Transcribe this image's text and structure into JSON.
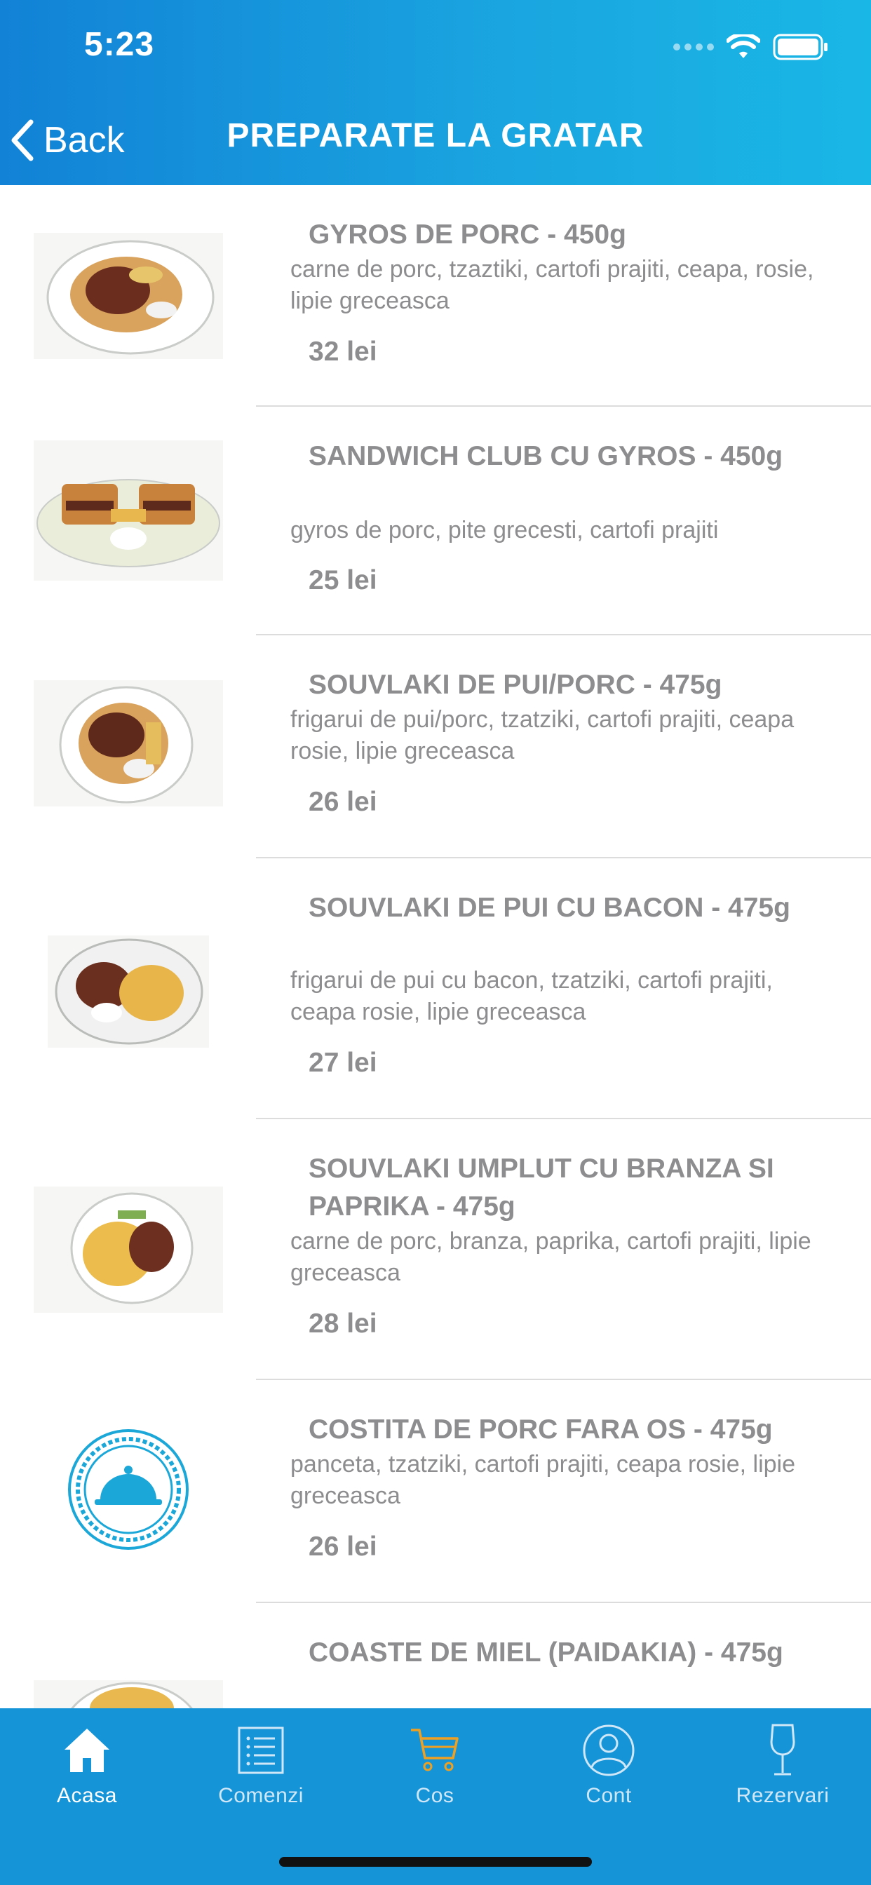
{
  "status_bar": {
    "time": "5:23"
  },
  "nav": {
    "back_label": "Back",
    "title": "PREPARATE LA GRATAR"
  },
  "items": [
    {
      "title": "GYROS DE PORC - 450g",
      "description": "carne de porc, tzaztiki, cartofi prajiti, ceapa, rosie, lipie greceasca",
      "price": "32 lei"
    },
    {
      "title": "SANDWICH CLUB CU GYROS - 450g",
      "description": "gyros de porc, pite grecesti, cartofi prajiti",
      "price": "25 lei"
    },
    {
      "title": "SOUVLAKI DE PUI/PORC - 475g",
      "description": "frigarui de pui/porc, tzatziki, cartofi prajiti, ceapa rosie, lipie greceasca",
      "price": "26 lei"
    },
    {
      "title": "SOUVLAKI DE PUI CU BACON - 475g",
      "description": "frigarui de pui cu bacon, tzatziki, cartofi prajiti, ceapa rosie, lipie greceasca",
      "price": "27 lei"
    },
    {
      "title": "SOUVLAKI UMPLUT CU BRANZA SI PAPRIKA - 475g",
      "description": "carne de porc, branza, paprika, cartofi prajiti, lipie greceasca",
      "price": "28 lei"
    },
    {
      "title": "COSTITA DE PORC FARA OS - 475g",
      "description": "panceta, tzatziki, cartofi prajiti, ceapa rosie, lipie greceasca",
      "price": "26 lei"
    },
    {
      "title": "COASTE DE MIEL (PAIDAKIA) - 475g",
      "description": "",
      "price": ""
    }
  ],
  "tabs": [
    {
      "label": "Acasa",
      "icon": "home-icon"
    },
    {
      "label": "Comenzi",
      "icon": "orders-list-icon"
    },
    {
      "label": "Cos",
      "icon": "cart-icon"
    },
    {
      "label": "Cont",
      "icon": "account-icon"
    },
    {
      "label": "Rezervari",
      "icon": "wine-glass-icon"
    }
  ],
  "colors": {
    "header": "#1a9be0",
    "tabbar": "#1694d8",
    "text_gray": "#8d8d8f",
    "cart_accent": "#f0a020",
    "placeholder_blue": "#1ba7d8"
  }
}
